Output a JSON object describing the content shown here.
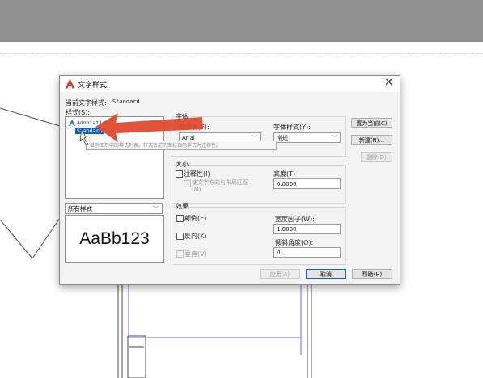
{
  "dialog": {
    "title": "文字样式",
    "current_style_label": "当前文字样式:",
    "current_style_value": "Standard",
    "styles_label": "样式(S):",
    "styles": [
      {
        "name": "Annotative",
        "selected": false
      },
      {
        "name": "Standard",
        "selected": true
      }
    ],
    "tooltip": "显示图形中的样式列表。样式名前的图标指示样式为注释性。",
    "filter_value": "所有样式",
    "preview_text": "AaBb123",
    "font": {
      "group_label": "字体",
      "font_name_label": "字体名(F):",
      "font_name_value": "Arial",
      "font_style_label": "字体样式(Y):",
      "font_style_value": "常规"
    },
    "size": {
      "group_label": "大小",
      "annotative_label": "注释性(I)",
      "annotative_checked": false,
      "match_orientation_label": "使文字方向与布局匹配(M)",
      "match_orientation_checked": false,
      "height_label": "高度(T)",
      "height_value": "0.0000"
    },
    "effects": {
      "group_label": "效果",
      "upside_down_label": "颠倒(E)",
      "backwards_label": "反向(K)",
      "vertical_label": "垂直(V)",
      "width_factor_label": "宽度因子(W):",
      "width_factor_value": "1.0000",
      "oblique_label": "倾斜角度(O):",
      "oblique_value": "0"
    },
    "buttons": {
      "set_current": "置为当前(C)",
      "new": "新建(N)...",
      "delete": "删除(D)",
      "apply": "应用(A)",
      "cancel": "取消",
      "help": "帮助(H)"
    }
  },
  "colors": {
    "title_bar_gray": "#8f8f8f",
    "selection_blue": "#0a64c8",
    "arrow_red": "#e04a2f",
    "autocad_logo_red": "#d83b2b"
  }
}
